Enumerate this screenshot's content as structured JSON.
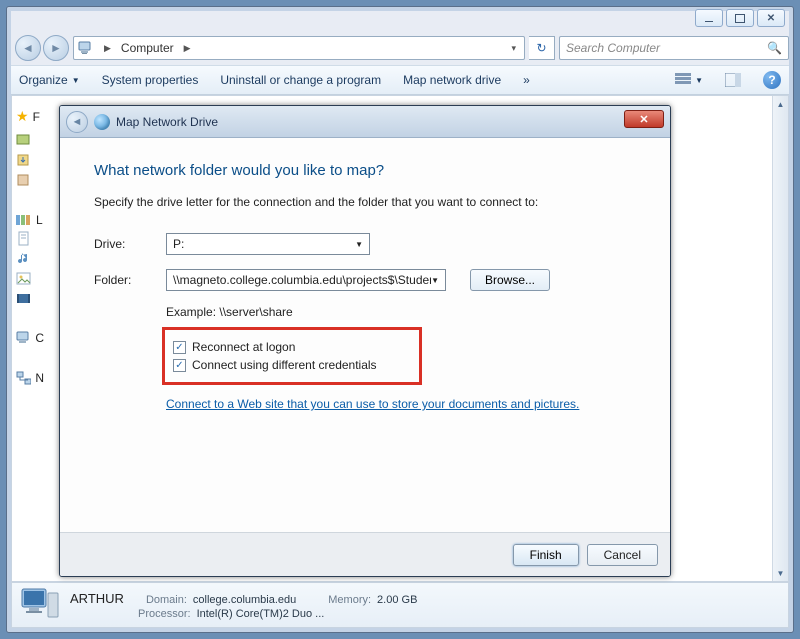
{
  "window": {
    "address": {
      "location": "Computer"
    },
    "search": {
      "placeholder": "Search Computer"
    }
  },
  "toolbar": {
    "organize": "Organize",
    "system_properties": "System properties",
    "uninstall": "Uninstall or change a program",
    "map_drive": "Map network drive",
    "more": "»"
  },
  "sidebar": {
    "favorites_label": "F",
    "libraries_label": "L",
    "computer_label": "C",
    "network_label": "N"
  },
  "details": {
    "name": "ARTHUR",
    "domain_label": "Domain:",
    "domain_value": "college.columbia.edu",
    "processor_label": "Processor:",
    "processor_value": "Intel(R) Core(TM)2 Duo ...",
    "memory_label": "Memory:",
    "memory_value": "2.00 GB"
  },
  "dialog": {
    "title": "Map Network Drive",
    "heading": "What network folder would you like to map?",
    "subtext": "Specify the drive letter for the connection and the folder that you want to connect to:",
    "drive_label": "Drive:",
    "drive_value": "P:",
    "folder_label": "Folder:",
    "folder_value": "\\\\magneto.college.columbia.edu\\projects$\\Studer",
    "browse_label": "Browse...",
    "example_label": "Example: \\\\server\\share",
    "reconnect_label": "Reconnect at logon",
    "reconnect_checked": true,
    "different_creds_label": "Connect using different credentials",
    "different_creds_checked": true,
    "website_link": "Connect to a Web site that you can use to store your documents and pictures",
    "finish_label": "Finish",
    "cancel_label": "Cancel"
  }
}
